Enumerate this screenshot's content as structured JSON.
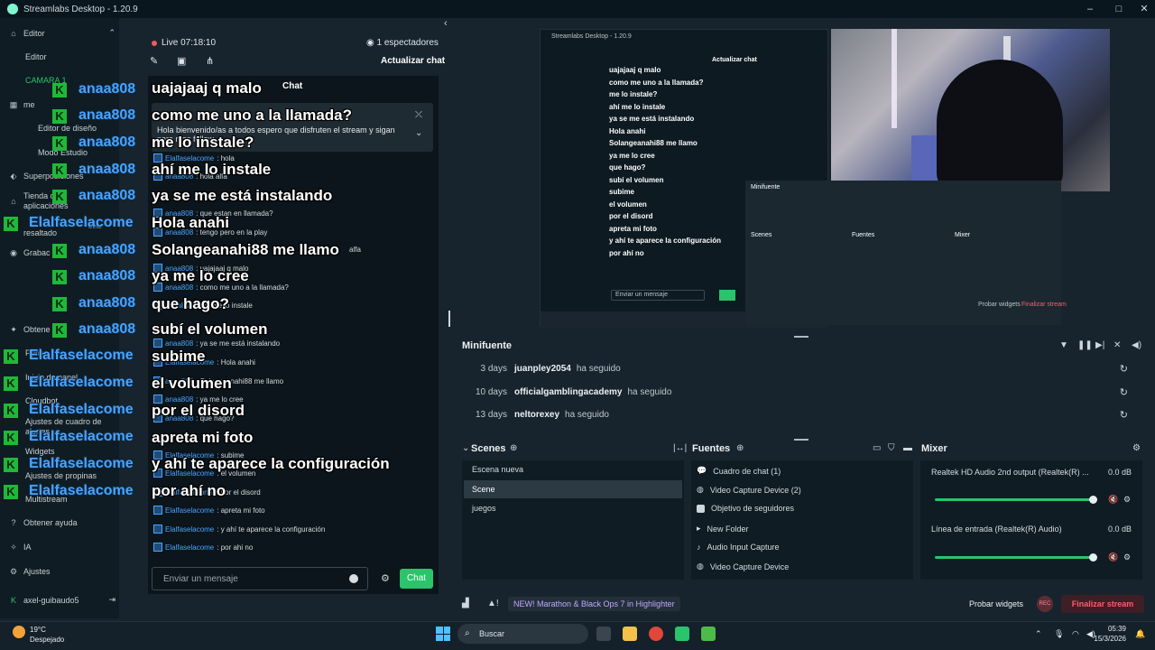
{
  "window": {
    "title": "Streamlabs Desktop - 1.20.9",
    "minimize": "–",
    "maximize": "□",
    "close": "✕"
  },
  "sidebar": {
    "items": [
      {
        "label": "Editor",
        "icon": "home-icon"
      },
      {
        "label": "Editor"
      },
      {
        "label": "CAMARA 1"
      },
      {
        "label": "me"
      },
      {
        "label": "Editor de diseño"
      },
      {
        "label": "Modo Estudio"
      },
      {
        "label": "Superposiciones"
      },
      {
        "label": "Tienda de aplicaciones"
      },
      {
        "label": "resaltado"
      },
      {
        "label": "Beta"
      },
      {
        "label": "Grabac"
      },
      {
        "label": "Obtene"
      },
      {
        "label": "Prime"
      },
      {
        "label": "Inicio de panel"
      },
      {
        "label": "Cloudbot"
      },
      {
        "label": "Ajustes de cuadro de alertas"
      },
      {
        "label": "Widgets"
      },
      {
        "label": "Ajustes de propinas"
      },
      {
        "label": "Multistream"
      },
      {
        "label": "Obtener ayuda"
      },
      {
        "label": "IA"
      },
      {
        "label": "Ajustes"
      }
    ],
    "user": "axel-guibaudo5"
  },
  "chat": {
    "live_label": "Live 07:18:10",
    "viewers": "1 espectadores",
    "refresh": "Actualizar chat",
    "chat_word": "Chat",
    "pinned_text": "Hola bienvenido/as a todos espero que disfruten el stream y sigan para mas follow",
    "overlay_messages": [
      "uajajaaj q malo",
      "como me uno a la llamada?",
      "me lo instale?",
      "ahí me lo instale",
      "ya se me está instalando",
      "Hola anahi",
      "Solangeanahi88 me llamo",
      "ya me lo cree",
      "que hago?",
      "subí el volumen",
      "subime",
      "el volumen",
      "por el disord",
      "apreta mi foto",
      "y ahí te aparece la configuración",
      "por ahí no"
    ],
    "overlay_names": [
      "anaa808",
      "anaa808",
      "anaa808",
      "anaa808",
      "anaa808",
      "Elalfaselacome",
      "anaa808",
      "anaa808",
      "anaa808",
      "anaa808",
      "Elalfaselacome",
      "Elalfaselacome",
      "Elalfaselacome",
      "Elalfaselacome",
      "Elalfaselacome",
      "Elalfaselacome"
    ],
    "small_messages": [
      {
        "user": "Elalfaselacome",
        "text": ": hola"
      },
      {
        "user": "anaa808",
        "text": ": hola alfa"
      },
      {
        "user": "anaa808",
        "text": ": que estan en llamada?"
      },
      {
        "user": "anaa808",
        "text": ": tengo pero en la play"
      },
      {
        "user": "",
        "text": "alfa"
      },
      {
        "user": "anaa808",
        "text": ": uajajaaj q malo"
      },
      {
        "user": "anaa808",
        "text": ": como me uno a la llamada?"
      },
      {
        "user": "anaa808",
        "text": ": ahí me lo instale"
      },
      {
        "user": "anaa808",
        "text": ": ya se me está instalando"
      },
      {
        "user": "Elalfaselacome",
        "text": ": Hola anahi"
      },
      {
        "user": "anaa808",
        "text": ": Solangeanahi88 me llamo"
      },
      {
        "user": "anaa808",
        "text": ": ya me lo cree"
      },
      {
        "user": "anaa808",
        "text": ": que hago?"
      },
      {
        "user": "Elalfaselacome",
        "text": ": subime"
      },
      {
        "user": "Elalfaselacome",
        "text": ": el volumen"
      },
      {
        "user": "Elalfaselacome",
        "text": ": por el disord"
      },
      {
        "user": "Elalfaselacome",
        "text": ": apreta mi foto"
      },
      {
        "user": "Elalfaselacome",
        "text": ": y ahí te aparece la configuración"
      },
      {
        "user": "Elalfaselacome",
        "text": ": por ahi no"
      }
    ],
    "input_placeholder": "Enviar un mensaje",
    "send": "Chat"
  },
  "minifuente": {
    "title": "Minifuente",
    "events": [
      {
        "days": "3 days",
        "name": "juanpley2054",
        "action": "ha seguido"
      },
      {
        "days": "10 days",
        "name": "officialgamblingacademy",
        "action": "ha seguido"
      },
      {
        "days": "13 days",
        "name": "neltorexey",
        "action": "ha seguido"
      }
    ]
  },
  "scenes": {
    "title": "Scenes",
    "items": [
      "Escena nueva",
      "Scene",
      "juegos"
    ],
    "active_index": 1
  },
  "sources": {
    "title": "Fuentes",
    "items": [
      "Cuadro de chat (1)",
      "Video Capture Device (2)",
      "Objetivo de seguidores",
      "New Folder",
      "Audio Input Capture",
      "Video Capture Device"
    ]
  },
  "mixer": {
    "title": "Mixer",
    "channels": [
      {
        "name": "Realtek HD Audio 2nd output (Realtek(R) ...",
        "db": "0.0 dB",
        "level": 1.0
      },
      {
        "name": "Línea de entrada (Realtek(R) Audio)",
        "db": "0.0 dB",
        "level": 1.0
      }
    ]
  },
  "footer": {
    "promo": "NEW! Marathon & Black Ops 7 in Highlighter",
    "probar": "Probar widgets",
    "rec": "REC",
    "end": "Finalizar stream"
  },
  "taskbar": {
    "temp": "19°C",
    "weather": "Despejado",
    "search": "Buscar",
    "time": "05:39",
    "date": "15/3/2026"
  },
  "preview_small": {
    "title": "Streamlabs Desktop - 1.20.9",
    "refresh": "Actualizar chat",
    "minifuente": "Minifuente",
    "scenes": "Scenes",
    "fuentes": "Fuentes",
    "mixer": "Mixer",
    "probar": "Probar widgets",
    "end": "Finalizar stream",
    "input": "Enviar un mensaje",
    "lines": [
      "uajajaaj q malo",
      "como me uno a la llamada?",
      "me lo instale?",
      "ahí me lo instale",
      "ya se me está instalando",
      "Hola anahi",
      "Solangeanahi88 me llamo",
      "ya me lo cree",
      "que hago?",
      "subí el volumen",
      "subime",
      "el volumen",
      "por el disord",
      "apreta mi foto",
      "y ahí te aparece la configuración",
      "por ahí no"
    ]
  },
  "accent": "#2ac46a"
}
